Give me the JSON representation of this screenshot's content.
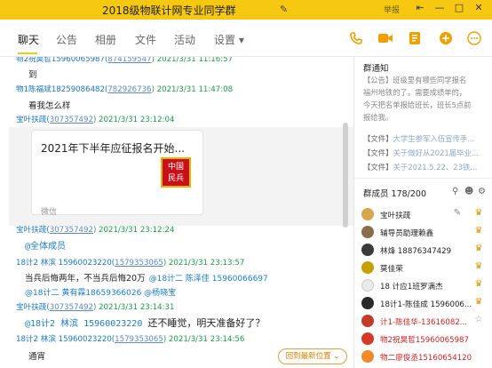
{
  "window": {
    "title": "2018级物联计网专业同学群",
    "report": "举报",
    "buttons": [
      "⇤",
      "—",
      "□",
      "✕"
    ]
  },
  "tabs": [
    "聊天",
    "公告",
    "相册",
    "文件",
    "活动",
    "设置 ▾"
  ],
  "actions": [
    "phone-icon",
    "video-icon",
    "apps-icon",
    "add-icon",
    "more-icon"
  ],
  "chat": {
    "messages": [
      {
        "sender": "物2祝昊哲15960065987(",
        "qq": "874159547",
        "time": ") 2021/3/31 11:16:57",
        "text": "到"
      },
      {
        "sender": "物1陈福斌18259086482(",
        "qq": "782926736",
        "time": ") 2021/3/31 11:47:08",
        "text": "看我怎么样"
      },
      {
        "sender": "宝叶扶疏(",
        "qq": "307357492",
        "time": ") 2021/3/31 23:12:04"
      }
    ],
    "card": {
      "title": "2021年下半年应征报名开始...",
      "logo": "中国\n民兵",
      "source": "微信"
    },
    "messages2": [
      {
        "sender": "宝叶扶疏(",
        "qq": "307357492",
        "time": ") 2021/3/31 23:12:24",
        "mention": "@全体成员"
      },
      {
        "sender": "18计2 林滨 15960023220(",
        "qq": "1579353065",
        "time": ") 2021/3/31 23:13:57",
        "text": "当兵后悔两年，不当兵后悔20万",
        "mention": "@18计二 陈泽佳 15960066697"
      },
      {
        "mention_line": "@18计二 黄有霖18659366026 @杨晓宝"
      },
      {
        "sender": "宝叶扶疏(",
        "qq": "307357492",
        "time": ") 2021/3/31 23:14:31",
        "mention": "@18计2 林滨 15960023220",
        "text": "还不睡觉，明天准备好了？"
      },
      {
        "sender": "18计2 林滨 15960023220(",
        "qq": "1579353065",
        "time": ") 2021/3/31 23:14:56",
        "text": "通宵"
      }
    ],
    "new_msg_button": "回到最新位置 ⌄"
  },
  "right": {
    "notice_title": "群通知",
    "notice_lines": [
      "【公告】班级里有哪些同学报名",
      "福州地铁的了，需要成绩单的，",
      "今天把名单报给班长，班长5点前",
      "报给我。"
    ],
    "files": [
      {
        "prefix": "【文件】",
        "name": "大学生参军入伍宣传手..."
      },
      {
        "prefix": "【文件】",
        "name": "关于做好从2021届毕业..."
      },
      {
        "prefix": "【文件】",
        "name": "关于2021.5.22、23铁..."
      }
    ],
    "members_title": "群成员 178/200",
    "members": [
      {
        "name": "宝叶扶疏",
        "color": "#d8a64c",
        "red": false
      },
      {
        "name": "辅导员助理赖鑫",
        "color": "#8a6d4a",
        "red": false
      },
      {
        "name": "林烽 18876347429",
        "color": "#3a3a3a",
        "red": false
      },
      {
        "name": "莫佳荣",
        "color": "#c4a000",
        "red": false
      },
      {
        "name": "18 计应1班罗满杰",
        "color": "#eaeaea",
        "red": false
      },
      {
        "name": "18计1-陈佳成 1596006...",
        "color": "#2a2a2a",
        "red": false
      },
      {
        "name": "计1-陈佳华-13616082...",
        "color": "#c23c28",
        "red": true
      },
      {
        "name": "物2祝昊哲15960065987",
        "color": "#d43a2a",
        "red": true
      },
      {
        "name": "物二廖俊丞15160654120",
        "color": "#f08a2a",
        "red": true
      }
    ]
  }
}
